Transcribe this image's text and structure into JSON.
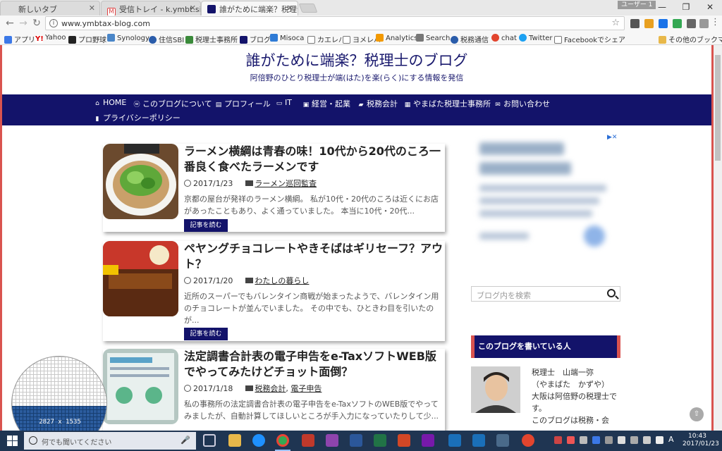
{
  "browser": {
    "tabs": [
      {
        "title": "新しいタブ",
        "icon": "blank-tab-icon",
        "active": false
      },
      {
        "title": "受信トレイ - k.ymbt.since@",
        "icon": "gmail-icon",
        "active": false
      },
      {
        "title": "誰がために端楽？税理士の",
        "icon": "blog-favicon-icon",
        "active": true
      }
    ],
    "user_badge": "ユーザー 1",
    "url": "www.ymbtax-blog.com",
    "bookmarks": [
      "アプリ",
      "Yahoo",
      "プロ野球",
      "Synology",
      "住信SBI",
      "税理士事務所",
      "ブログ",
      "Misoca",
      "カエレバ",
      "ヨメレバ",
      "Analytics",
      "Search",
      "税務通信",
      "chat",
      "Twitter",
      "Facebookでシェア"
    ],
    "other_bookmarks": "その他のブックマーク"
  },
  "site": {
    "title": "誰がために端楽？税理士のブログ",
    "description": "阿倍野のひとり税理士が端(はた)を楽(らく)にする情報を発信",
    "nav": [
      {
        "label": "HOME",
        "icon": "home-icon"
      },
      {
        "label": "このブログについて",
        "icon": "wordpress-icon"
      },
      {
        "label": "プロフィール",
        "icon": "document-icon"
      },
      {
        "label": "IT",
        "icon": "monitor-icon"
      },
      {
        "label": "経営・起業",
        "icon": "money-icon"
      },
      {
        "label": "税務会計",
        "icon": "book-icon"
      },
      {
        "label": "やまばた税理士事務所",
        "icon": "calculator-icon"
      },
      {
        "label": "お問い合わせ",
        "icon": "envelope-icon"
      },
      {
        "label": "プライバシーポリシー",
        "icon": "privacy-icon"
      }
    ]
  },
  "posts": [
    {
      "title": "ラーメン横綱は青春の味！10代から20代のころ一番良く食べたラーメンです",
      "date": "2017/1/23",
      "categories": [
        "ラーメン巡回監査"
      ],
      "excerpt": "京都の屋台が発祥のラーメン横綱。 私が10代・20代のころは近くにお店があったこともあり、よく通っていました。 本当に10代・20代...",
      "read_more": "記事を読む"
    },
    {
      "title": "ペヤングチョコレートやきそばはギリセーフ？アウト？",
      "date": "2017/1/20",
      "categories": [
        "わたしの暮らし"
      ],
      "excerpt": "近所のスーパーでもバレンタイン商戦が始まったようで、バレンタイン用のチョコレートが並んでいました。 その中でも、ひときわ目を引いたのが...",
      "read_more": "記事を読む"
    },
    {
      "title": "法定調書合計表の電子申告をe-TaxソフトWEB版でやってみたけどチョット面倒？",
      "date": "2017/1/18",
      "categories": [
        "税務会計",
        "電子申告"
      ],
      "category_separator": ",",
      "excerpt": "私の事務所の法定調書合計表の電子申告をe-TaxソフトのWEB版でやってみましたが、自動計算してほしいところが手入力になっていたりして少...",
      "read_more": "記事を読む"
    }
  ],
  "sidebar": {
    "search_placeholder": "ブログ内を検索",
    "widget_title": "このブログを書いている人",
    "profile_lines": [
      "税理士　山端一弥",
      "（やまばた　かずや）",
      "大阪は阿倍野の税理士です。",
      "このブログは税務・会"
    ]
  },
  "magnifier": {
    "readout": "2827  x  1535"
  },
  "taskbar": {
    "search_placeholder": "何でも聞いてください",
    "time": "10:43",
    "date": "2017/01/23",
    "ime": "A"
  },
  "colors": {
    "site_navy": "#13136a",
    "accent_red": "#d9534f",
    "taskbar": "#1f3552"
  }
}
